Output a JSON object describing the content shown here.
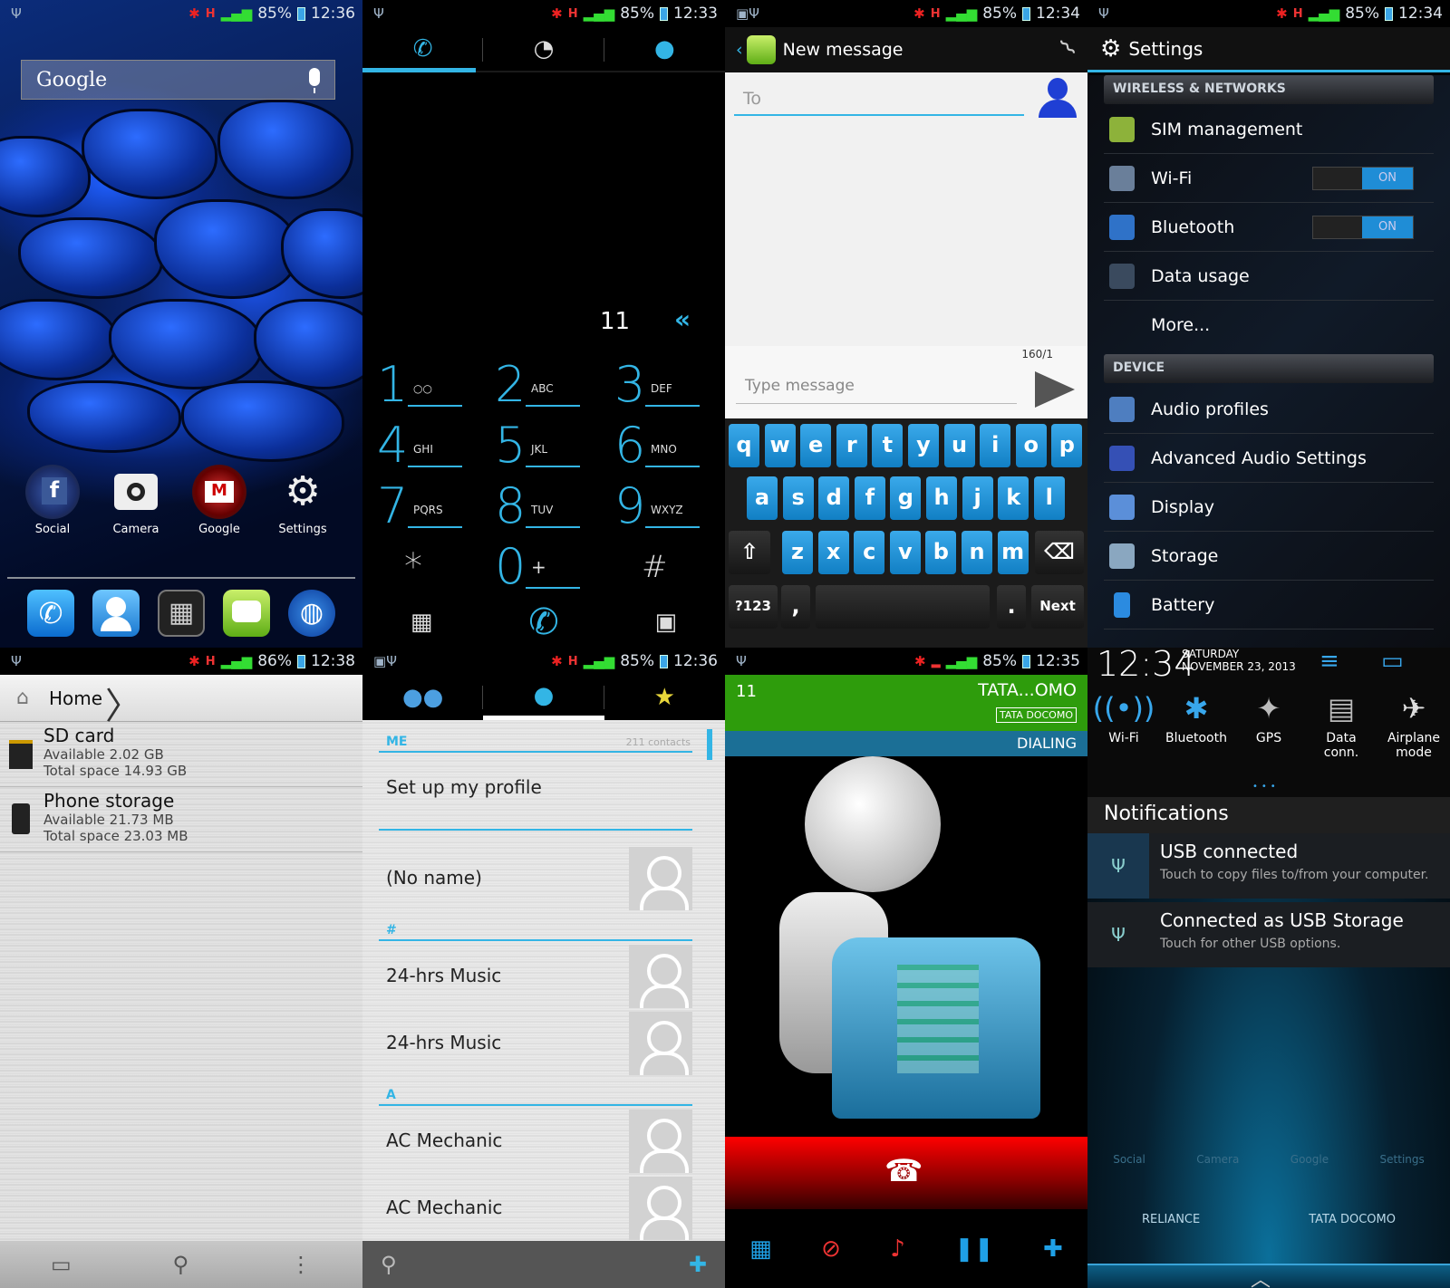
{
  "status": {
    "home": {
      "battery": "85%",
      "time": "12:36"
    },
    "dialer": {
      "battery": "85%",
      "time": "12:33"
    },
    "message": {
      "battery": "85%",
      "time": "12:34"
    },
    "settings": {
      "battery": "85%",
      "time": "12:34"
    },
    "storage": {
      "battery": "86%",
      "time": "12:38"
    },
    "contacts": {
      "battery": "85%",
      "time": "12:36"
    },
    "call": {
      "battery": "85%",
      "time": "12:35"
    }
  },
  "home": {
    "search_logo": "Google",
    "apps": [
      {
        "label": "Social"
      },
      {
        "label": "Camera"
      },
      {
        "label": "Google"
      },
      {
        "label": "Settings"
      }
    ]
  },
  "dialer": {
    "number": "11",
    "keys": [
      {
        "digit": "1",
        "letters": "○○"
      },
      {
        "digit": "2",
        "letters": "ABC"
      },
      {
        "digit": "3",
        "letters": "DEF"
      },
      {
        "digit": "4",
        "letters": "GHI"
      },
      {
        "digit": "5",
        "letters": "JKL"
      },
      {
        "digit": "6",
        "letters": "MNO"
      },
      {
        "digit": "7",
        "letters": "PQRS"
      },
      {
        "digit": "8",
        "letters": "TUV"
      },
      {
        "digit": "9",
        "letters": "WXYZ"
      },
      {
        "digit": "*",
        "letters": ""
      },
      {
        "digit": "0",
        "letters": "+"
      },
      {
        "digit": "#",
        "letters": ""
      }
    ]
  },
  "message": {
    "title": "New message",
    "to_placeholder": "To",
    "counter": "160/1",
    "type_placeholder": "Type message",
    "row1": [
      "q",
      "w",
      "e",
      "r",
      "t",
      "y",
      "u",
      "i",
      "o",
      "p"
    ],
    "row2": [
      "a",
      "s",
      "d",
      "f",
      "g",
      "h",
      "j",
      "k",
      "l"
    ],
    "row3": [
      "z",
      "x",
      "c",
      "v",
      "b",
      "n",
      "m"
    ],
    "sym": "?123",
    "comma": ",",
    "period": ".",
    "next": "Next"
  },
  "settings": {
    "title": "Settings",
    "sec1": "WIRELESS & NETWORKS",
    "sec2": "DEVICE",
    "items1": [
      {
        "label": "SIM management"
      },
      {
        "label": "Wi-Fi",
        "toggle": "ON"
      },
      {
        "label": "Bluetooth",
        "toggle": "ON"
      },
      {
        "label": "Data usage"
      },
      {
        "label": "More..."
      }
    ],
    "items2": [
      {
        "label": "Audio profiles"
      },
      {
        "label": "Advanced Audio Settings"
      },
      {
        "label": "Display"
      },
      {
        "label": "Storage"
      },
      {
        "label": "Battery"
      }
    ]
  },
  "storage": {
    "crumb": "Home",
    "items": [
      {
        "title": "SD card",
        "avail": "Available 2.02 GB",
        "total": "Total space 14.93 GB"
      },
      {
        "title": "Phone storage",
        "avail": "Available 21.73 MB",
        "total": "Total space 23.03 MB"
      }
    ]
  },
  "contacts": {
    "me": "ME",
    "count": "211 contacts",
    "setup": "Set up my profile",
    "noname": "(No name)",
    "hash": "#",
    "a": "A",
    "rows": [
      "24-hrs Music",
      "24-hrs Music",
      "AC Mechanic",
      "AC Mechanic"
    ]
  },
  "call": {
    "number": "11",
    "name": "TATA...OMO",
    "carrier": "TATA DOCOMO",
    "state": "DIALING"
  },
  "notif": {
    "time": "12:34",
    "day": "SATURDAY",
    "date": "NOVEMBER 23, 2013",
    "qs": [
      {
        "label": "Wi-Fi"
      },
      {
        "label": "Bluetooth"
      },
      {
        "label": "GPS"
      },
      {
        "label": "Data conn."
      },
      {
        "label": "Airplane mode"
      }
    ],
    "heading": "Notifications",
    "items": [
      {
        "title": "USB connected",
        "sub": "Touch to copy files to/from your computer."
      },
      {
        "title": "Connected as USB Storage",
        "sub": "Touch for other USB options."
      }
    ],
    "sims": [
      "RELIANCE",
      "TATA DOCOMO"
    ],
    "ghost": [
      "Social",
      "Camera",
      "Google",
      "Settings"
    ]
  },
  "colors": {
    "accent": "#33b5e5",
    "call_green": "#2e9c0c",
    "end_red": "#e00000"
  }
}
